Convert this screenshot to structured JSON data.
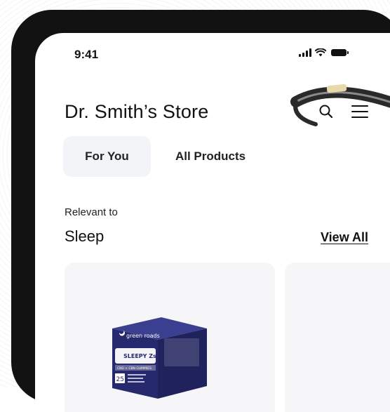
{
  "status_bar": {
    "time": "9:41"
  },
  "header": {
    "store_title": "Dr. Smith’s Store",
    "icons": [
      "search-icon",
      "hamburger-menu-icon"
    ]
  },
  "tabs": [
    {
      "label": "For You",
      "selected": true
    },
    {
      "label": "All Products",
      "selected": false
    }
  ],
  "section": {
    "eyebrow": "Relevant to",
    "title": "Sleep",
    "view_all": "View All"
  },
  "products": [
    {
      "brand": "green roads",
      "product_name": "SLEEPY Zs",
      "subtitle": "CBD + CBN GUMMIES",
      "count": "25"
    }
  ],
  "colors": {
    "frame": "#121212",
    "selected_tab_bg": "#f2f4f7",
    "card_bg": "#f6f5f7",
    "box_navy": "#26296e"
  }
}
